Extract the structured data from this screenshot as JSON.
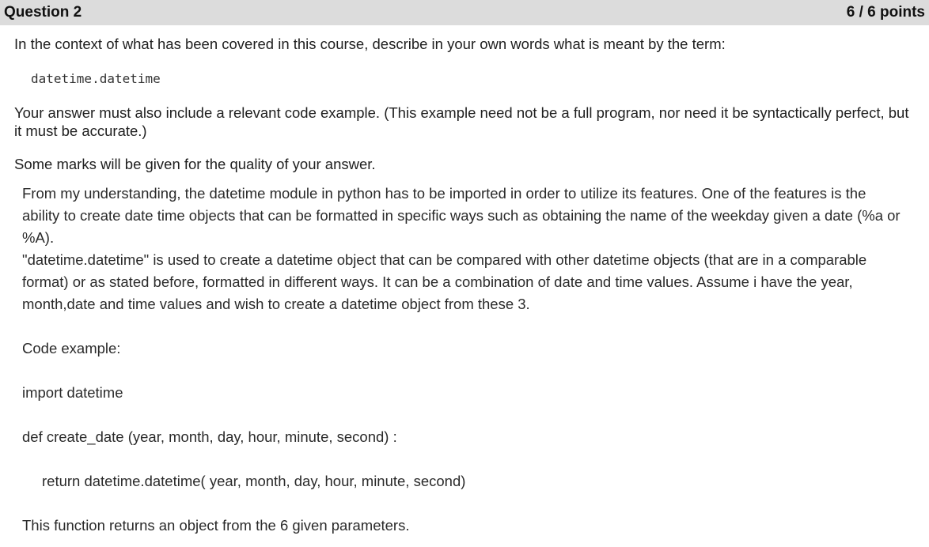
{
  "question": {
    "title": "Question 2",
    "points": "6 / 6 points",
    "prompt": "In the context of what has been covered in this course, describe in your own words what is meant by the term:",
    "term": "datetime.datetime",
    "requirement": "Your answer must also include a relevant code example. (This example need not be a full program, nor need it be syntactically perfect, but it must be accurate.)",
    "marks_note": "Some marks will be given for the quality of your answer."
  },
  "answer": {
    "paragraph1": "From my understanding, the datetime module in python has to be imported in order to utilize its features. One of the features is the ability to create date time objects that can be formatted in specific ways such as obtaining the name of the weekday given a date (%a or %A).",
    "paragraph2": "\"datetime.datetime\" is used to create a datetime object that can be compared with other datetime objects (that are in a comparable format) or as stated before, formatted in different ways. It can be a combination of date and time values. Assume i have the year, month,date and time values and wish to create a datetime object from these 3.",
    "code_label": "Code example:",
    "code_import": "import datetime",
    "code_def": "def create_date (year, month, day, hour, minute, second) :",
    "code_return": "return datetime.datetime( year, month, day, hour, minute, second)",
    "closing": "This function returns an object from the 6 given parameters."
  }
}
